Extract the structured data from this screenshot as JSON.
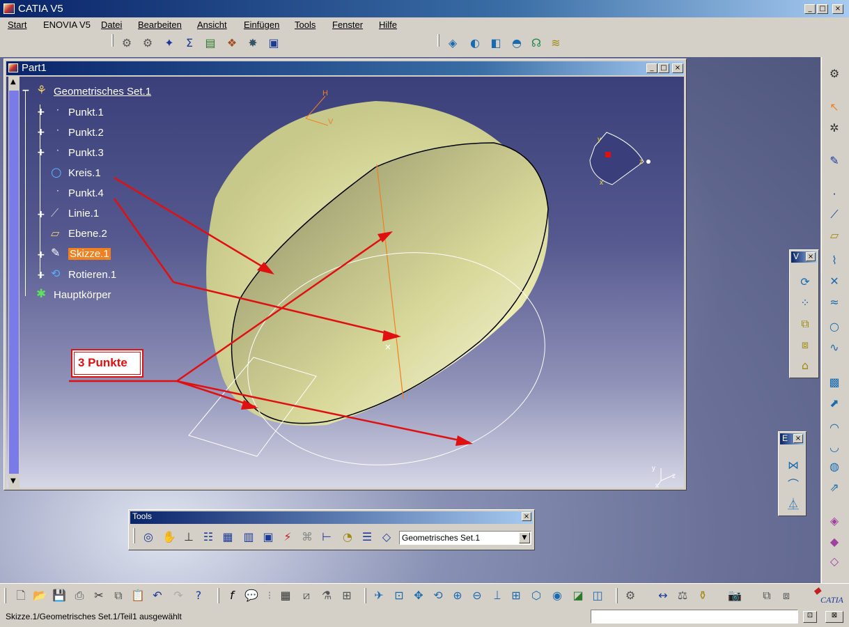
{
  "app": {
    "title": "CATIA V5",
    "window_buttons": [
      "_",
      "□",
      "×"
    ]
  },
  "menu": [
    {
      "label": "Start"
    },
    {
      "label": "ENOVIA V5"
    },
    {
      "label": "Datei"
    },
    {
      "label": "Bearbeiten"
    },
    {
      "label": "Ansicht"
    },
    {
      "label": "Einfügen"
    },
    {
      "label": "Tools"
    },
    {
      "label": "Fenster"
    },
    {
      "label": "Hilfe"
    }
  ],
  "document": {
    "title": "Part1",
    "tree": [
      {
        "label": "Geometrisches Set.1",
        "icon": "geometrical-set-icon",
        "glyph": "⚘"
      },
      {
        "label": "Punkt.1",
        "icon": "point-icon",
        "glyph": "·"
      },
      {
        "label": "Punkt.2",
        "icon": "point-icon",
        "glyph": "·"
      },
      {
        "label": "Punkt.3",
        "icon": "point-icon",
        "glyph": "·"
      },
      {
        "label": "Kreis.1",
        "icon": "circle-icon",
        "glyph": "○"
      },
      {
        "label": "Punkt.4",
        "icon": "point-icon",
        "glyph": "·"
      },
      {
        "label": "Linie.1",
        "icon": "line-icon",
        "glyph": "⟋"
      },
      {
        "label": "Ebene.2",
        "icon": "plane-icon",
        "glyph": "▱"
      },
      {
        "label": "Skizze.1",
        "icon": "sketch-icon",
        "glyph": "✎"
      },
      {
        "label": "Rotieren.1",
        "icon": "revolve-icon",
        "glyph": "⟲"
      },
      {
        "label": "Hauptkörper",
        "icon": "body-icon",
        "glyph": "✱"
      }
    ]
  },
  "annotation": {
    "label": "3 Punkte",
    "color": "#e01010"
  },
  "compass": {
    "axis_labels": [
      "y",
      "z",
      "x"
    ]
  },
  "axes_corner": [
    "y",
    "z",
    "x"
  ],
  "plane_labels": {
    "h": "H",
    "v": "V"
  },
  "floating_toolbars": {
    "v": {
      "title": "V"
    },
    "e": {
      "title": "E"
    },
    "tools": {
      "title": "Tools",
      "combo_value": "Geometrisches Set.1"
    }
  },
  "status": {
    "text": "Skizze.1/Geometrisches Set.1/Teil1  ausgewählt",
    "input_value": ""
  },
  "icons": {
    "top_toolbar": [
      "gear-icon",
      "gears-icon",
      "knowledge-icon",
      "formula-icon",
      "sheet-icon",
      "catalog-icon",
      "analysis-icon",
      "save-icon"
    ],
    "top_toolbar_right": [
      "view-mode-icon",
      "render-icon",
      "hide-icon",
      "shading-icon",
      "lights-icon",
      "layers-icon"
    ]
  },
  "colors": {
    "selection_highlight": "#f08020",
    "arrow_color": "#e01010",
    "surface_color": "#f2f2b8"
  }
}
